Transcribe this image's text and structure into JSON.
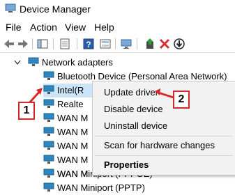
{
  "window": {
    "title": "Device Manager"
  },
  "menu": {
    "items": [
      "File",
      "Action",
      "View",
      "Help"
    ]
  },
  "toolbar": {
    "icons": [
      "back-arrow-icon",
      "forward-arrow-icon",
      "show-hide-tree-icon",
      "properties-icon",
      "help-icon",
      "scan-icon",
      "monitor-icon",
      "update-driver-icon",
      "uninstall-icon",
      "disable-icon"
    ]
  },
  "tree": {
    "category": "Network adapters",
    "items": [
      "Bluetooth Device (Personal Area Network)",
      "Intel(R",
      "Realte",
      "WAN M",
      "WAN M",
      "WAN M",
      "WAN M",
      "WAN M",
      "WAN Miniport (PPPOE)",
      "WAN Miniport (PPTP)"
    ]
  },
  "context_menu": {
    "items": [
      "Update driver",
      "Disable device",
      "Uninstall device",
      "Scan for hardware changes",
      "Properties"
    ]
  },
  "annotations": {
    "badge1": "1",
    "badge2": "2",
    "accent": "#d8282a"
  },
  "colors": {
    "network_icon": "#2e86c1",
    "toolbar_red": "#d32f2f"
  }
}
